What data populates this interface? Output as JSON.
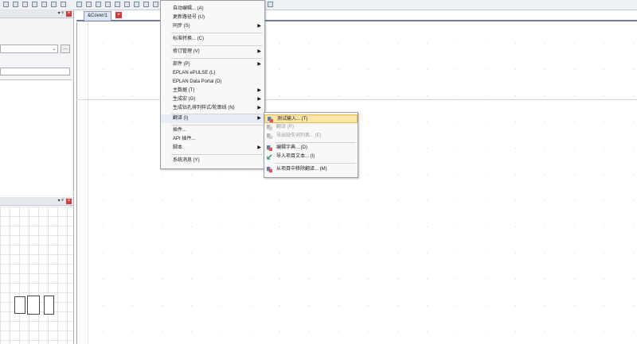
{
  "document_tab": {
    "label": "&Cover/1",
    "close": "×"
  },
  "panels": {
    "upper_pin": "▾ ᵠ",
    "upper_close": "×",
    "lower_pin": "▾ ᵠ",
    "lower_close": "×",
    "combo_arrow": "⌄",
    "dots": "…"
  },
  "main_menu": {
    "items": [
      {
        "label": "自动编辑... (A)"
      },
      {
        "label": "更新路径号 (U)"
      },
      {
        "label": "同步 (S)",
        "arrow": "▶"
      },
      {
        "label": "标准转换... (C)"
      },
      {
        "label": "修订管理 (V)",
        "arrow": "▶"
      },
      {
        "label": "部件 (P)",
        "arrow": "▶"
      },
      {
        "label": "EPLAN ePULSE (L)"
      },
      {
        "label": "EPLAN Data Portal (D)"
      },
      {
        "label": "主数据 (T)",
        "arrow": "▶"
      },
      {
        "label": "生成宏 (G)",
        "arrow": "▶"
      },
      {
        "label": "生成钻孔排列样式/轮廓线 (N)",
        "arrow": "▶"
      },
      {
        "label": "翻译 (I)",
        "arrow": "▶"
      },
      {
        "label": "插件..."
      },
      {
        "label": "API 插件..."
      },
      {
        "label": "脚本",
        "arrow": "▶"
      },
      {
        "label": "系统消息 (Y)"
      }
    ]
  },
  "sub_menu": {
    "items": [
      {
        "label": "测试输入... (T)"
      },
      {
        "label": "翻译 (R)"
      },
      {
        "label": "导出缺失词列表... (E)"
      },
      {
        "label": "编辑字典... (D)"
      },
      {
        "label": "导入项目文本... (I)"
      },
      {
        "label": "从项目中移除翻译... (M)"
      }
    ]
  },
  "colors": {
    "highlight": "#fbe6a8",
    "tab_close": "#d23b3b",
    "accent": "#6a7fa8"
  }
}
